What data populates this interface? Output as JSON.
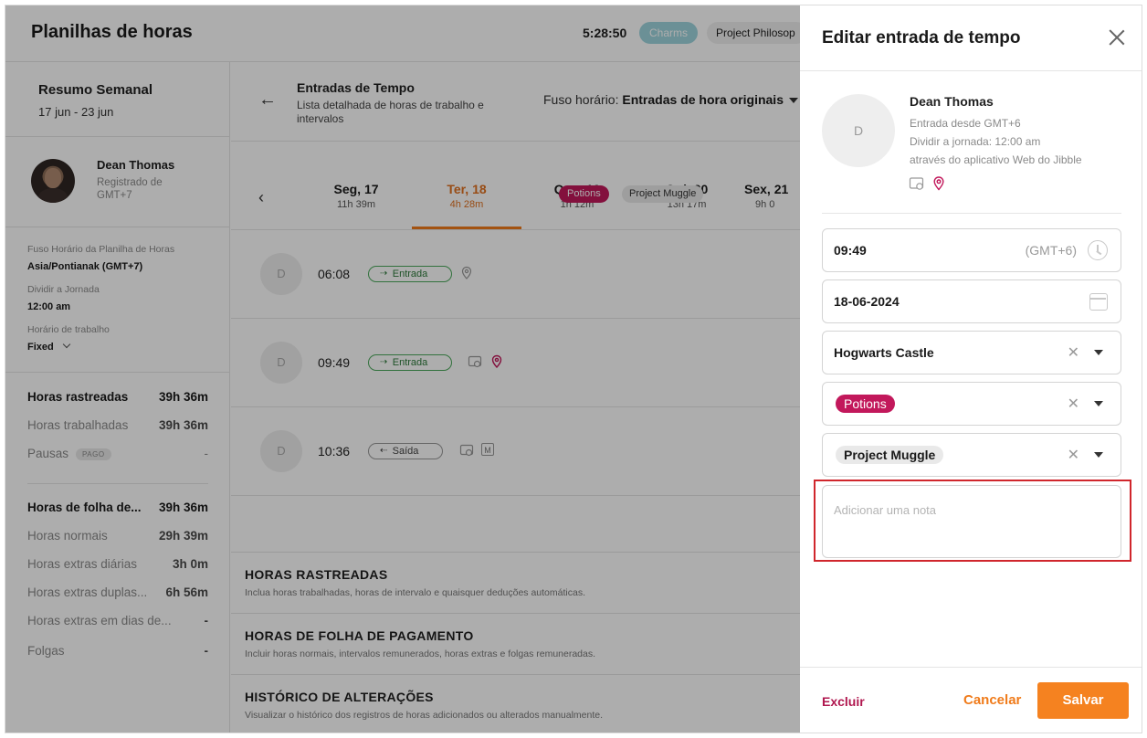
{
  "header": {
    "title": "Planilhas de horas",
    "timer": "5:28:50",
    "activity_chip": "Charms",
    "project_chip": "Project Philosop",
    "colors": {
      "activity_chip": "#9ed5de"
    }
  },
  "sidebar": {
    "week_title": "Resumo Semanal",
    "week_range": "17 jun - 23 jun",
    "user_name": "Dean Thomas",
    "registered": "Registrado de GMT+7",
    "timezone_label": "Fuso Horário da Planilha de Horas",
    "timezone_value": "Asia/Pontianak (GMT+7)",
    "split_label": "Dividir a Jornada",
    "split_value": "12:00 am",
    "schedule_label": "Horário de trabalho",
    "schedule_value": "Fixed",
    "stats": [
      {
        "label": "Horas rastreadas",
        "value": "39h 36m"
      },
      {
        "label": "Horas trabalhadas",
        "value": "39h 36m"
      },
      {
        "label": "Pausas",
        "badge": "PAGO",
        "value": "-"
      },
      {
        "label": "Horas de folha de...",
        "value": "39h 36m"
      },
      {
        "label": "Horas normais",
        "value": "29h 39m"
      },
      {
        "label": "Horas extras diárias",
        "value": "3h 0m"
      },
      {
        "label": "Horas extras duplas...",
        "value": "6h 56m"
      },
      {
        "label": "Horas extras em dias de...",
        "value": "-"
      },
      {
        "label": "Folgas",
        "value": "-"
      }
    ]
  },
  "main": {
    "entries_title": "Entradas de Tempo",
    "entries_subtitle": "Lista detalhada de horas de trabalho e intervalos",
    "timezone_prefix": "Fuso horário:",
    "timezone_value": "Entradas de hora originais",
    "days": [
      {
        "name": "Seg, 17",
        "hours": "11h 39m",
        "active": false
      },
      {
        "name": "Ter, 18",
        "hours": "4h 28m",
        "active": true
      },
      {
        "name": "Qua, 19",
        "hours": "1h 12m",
        "active": false
      },
      {
        "name": "Qui, 20",
        "hours": "13h 17m",
        "active": false
      },
      {
        "name": "Sex, 21",
        "hours": "9h 0",
        "active": false
      }
    ],
    "entries": [
      {
        "avatar": "D",
        "time": "06:08",
        "type": "Entrada"
      },
      {
        "avatar": "D",
        "time": "09:49",
        "type": "Entrada",
        "activity": "Potions",
        "project": "Project Muggle"
      },
      {
        "avatar": "D",
        "time": "10:36",
        "type": "Saída",
        "mode_badge": "M"
      }
    ],
    "sections": [
      {
        "title": "HORAS RASTREADAS",
        "desc": "Inclua horas trabalhadas, horas de intervalo e quaisquer deduções automáticas."
      },
      {
        "title": "HORAS DE FOLHA DE PAGAMENTO",
        "desc": "Incluir horas normais, intervalos remunerados, horas extras e folgas remuneradas."
      },
      {
        "title": "HISTÓRICO DE ALTERAÇÕES",
        "desc": "Visualizar o histórico dos registros de horas adicionados ou alterados manualmente."
      }
    ]
  },
  "drawer": {
    "title": "Editar entrada de tempo",
    "avatar": "D",
    "name": "Dean Thomas",
    "meta": [
      "Entrada desde GMT+6",
      "Dividir a jornada: 12:00 am",
      "através do aplicativo Web do Jibble"
    ],
    "time_value": "09:49",
    "time_tz": "(GMT+6)",
    "date_value": "18-06-2024",
    "location": "Hogwarts Castle",
    "activity": "Potions",
    "project": "Project Muggle",
    "note_placeholder": "Adicionar uma nota",
    "delete_label": "Excluir",
    "cancel_label": "Cancelar",
    "save_label": "Salvar",
    "colors": {
      "accent": "#f58220",
      "activity": "#c2185b",
      "delete": "#b0174f",
      "highlight": "#d0262c"
    }
  }
}
